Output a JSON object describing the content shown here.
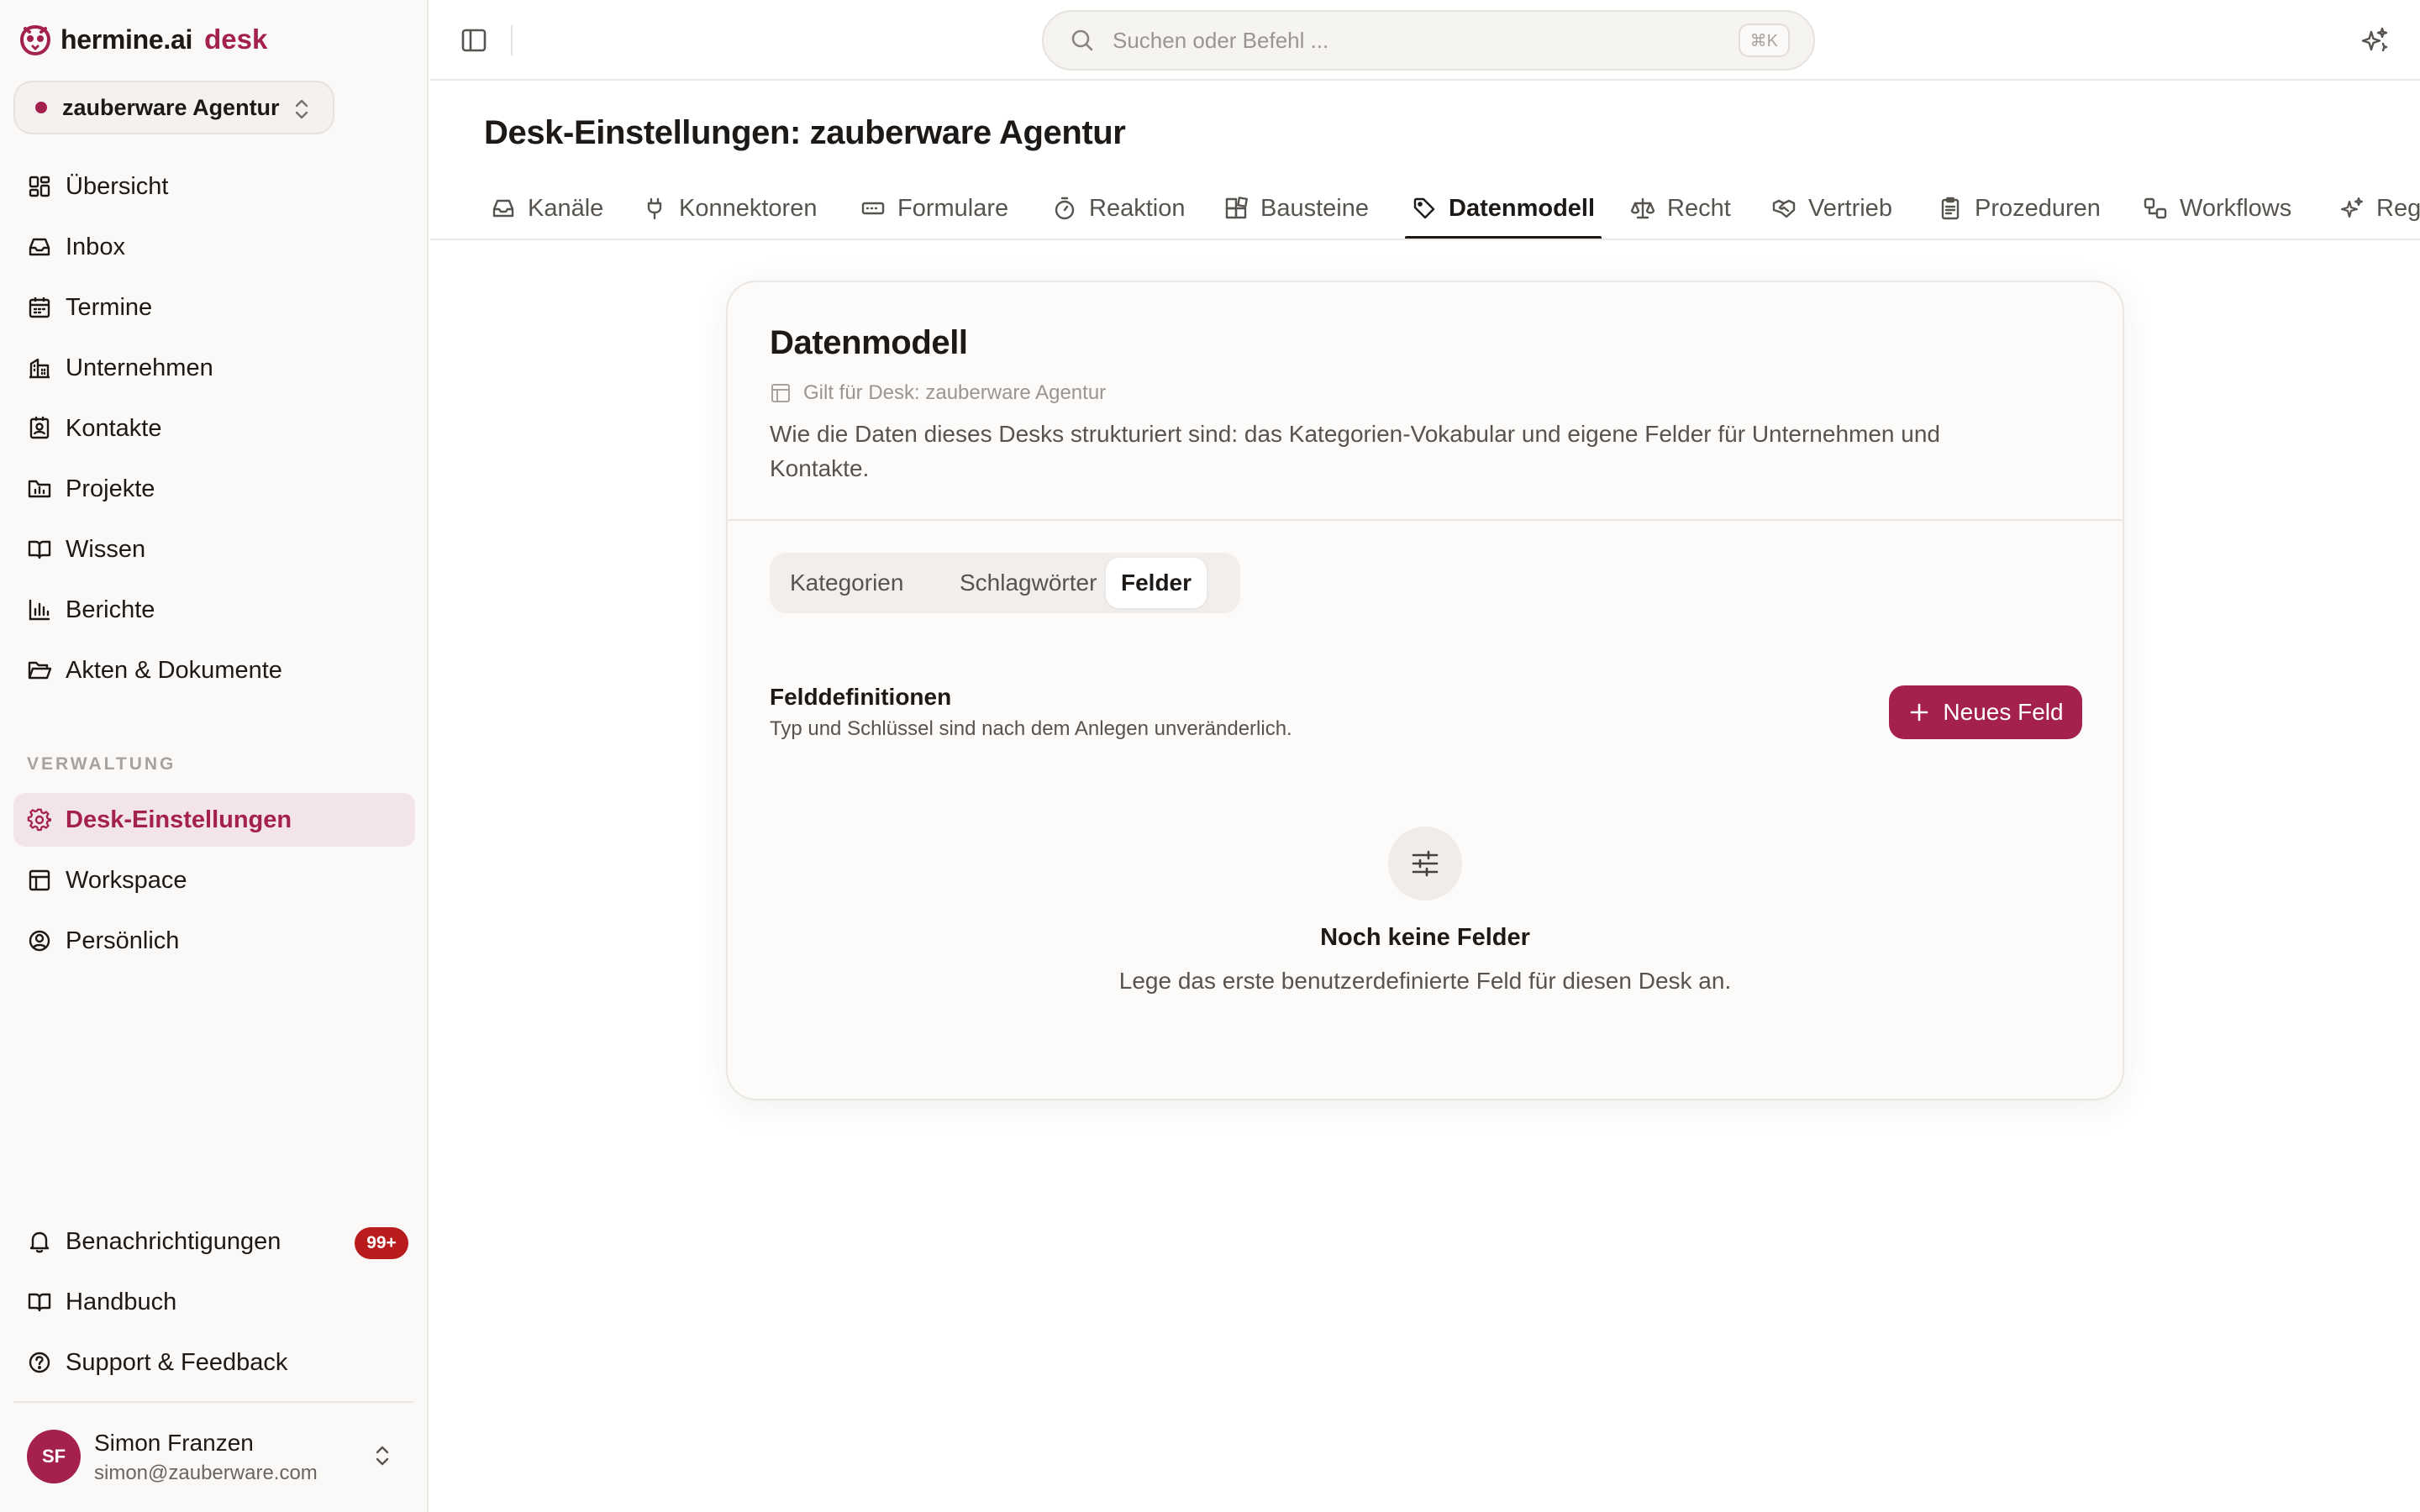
{
  "brand": {
    "name": "hermine.ai",
    "product": "desk"
  },
  "desk_switcher": {
    "label": "zauberware Agentur"
  },
  "sidebar": {
    "main_items": [
      {
        "label": "Übersicht",
        "icon": "dashboard-icon"
      },
      {
        "label": "Inbox",
        "icon": "inbox-icon"
      },
      {
        "label": "Termine",
        "icon": "calendar-icon"
      },
      {
        "label": "Unternehmen",
        "icon": "building-icon"
      },
      {
        "label": "Kontakte",
        "icon": "contact-card-icon"
      },
      {
        "label": "Projekte",
        "icon": "folder-chart-icon"
      },
      {
        "label": "Wissen",
        "icon": "book-open-icon"
      },
      {
        "label": "Berichte",
        "icon": "bar-chart-icon"
      },
      {
        "label": "Akten & Dokumente",
        "icon": "folder-open-icon"
      }
    ],
    "section_label": "VERWALTUNG",
    "admin_items": [
      {
        "label": "Desk-Einstellungen",
        "icon": "gear-icon",
        "active": true
      },
      {
        "label": "Workspace",
        "icon": "layout-icon"
      },
      {
        "label": "Persönlich",
        "icon": "user-circle-icon"
      }
    ],
    "bottom_items": [
      {
        "label": "Benachrichtigungen",
        "icon": "bell-icon",
        "badge": "99+"
      },
      {
        "label": "Handbuch",
        "icon": "book-icon"
      },
      {
        "label": "Support & Feedback",
        "icon": "help-circle-icon"
      }
    ],
    "user": {
      "initials": "SF",
      "name": "Simon Franzen",
      "email": "simon@zauberware.com"
    }
  },
  "topbar": {
    "search_placeholder": "Suchen oder Befehl ...",
    "search_shortcut": "⌘K"
  },
  "page": {
    "title": "Desk-Einstellungen: zauberware Agentur",
    "tabs": [
      {
        "label": "Kanäle",
        "icon": "inbox-icon"
      },
      {
        "label": "Konnektoren",
        "icon": "plug-icon"
      },
      {
        "label": "Formulare",
        "icon": "form-icon"
      },
      {
        "label": "Reaktion",
        "icon": "timer-icon"
      },
      {
        "label": "Bausteine",
        "icon": "blocks-icon"
      },
      {
        "label": "Datenmodell",
        "icon": "tag-icon",
        "active": true
      },
      {
        "label": "Recht",
        "icon": "scale-icon"
      },
      {
        "label": "Vertrieb",
        "icon": "handshake-icon"
      },
      {
        "label": "Prozeduren",
        "icon": "clipboard-icon"
      },
      {
        "label": "Workflows",
        "icon": "workflow-icon"
      },
      {
        "label": "Reg",
        "icon": "sparkles-icon"
      }
    ]
  },
  "card": {
    "title": "Datenmodell",
    "scope": "Gilt für Desk: zauberware Agentur",
    "description": "Wie die Daten dieses Desks strukturiert sind: das Kategorien-Vokabular und eigene Felder für Unternehmen und Kontakte.",
    "segments": [
      {
        "label": "Kategorien"
      },
      {
        "label": "Schlagwörter"
      },
      {
        "label": "Felder",
        "active": true
      }
    ],
    "section_title": "Felddefinitionen",
    "section_subtitle": "Typ und Schlüssel sind nach dem Anlegen unveränderlich.",
    "new_button": "Neues Feld",
    "empty_title": "Noch keine Felder",
    "empty_subtitle": "Lege das erste benutzerdefinierte Feld für diesen Desk an."
  },
  "colors": {
    "accent": "#a3204f",
    "active_nav_bg": "#f2e4e7",
    "badge": "#b91c1c"
  }
}
